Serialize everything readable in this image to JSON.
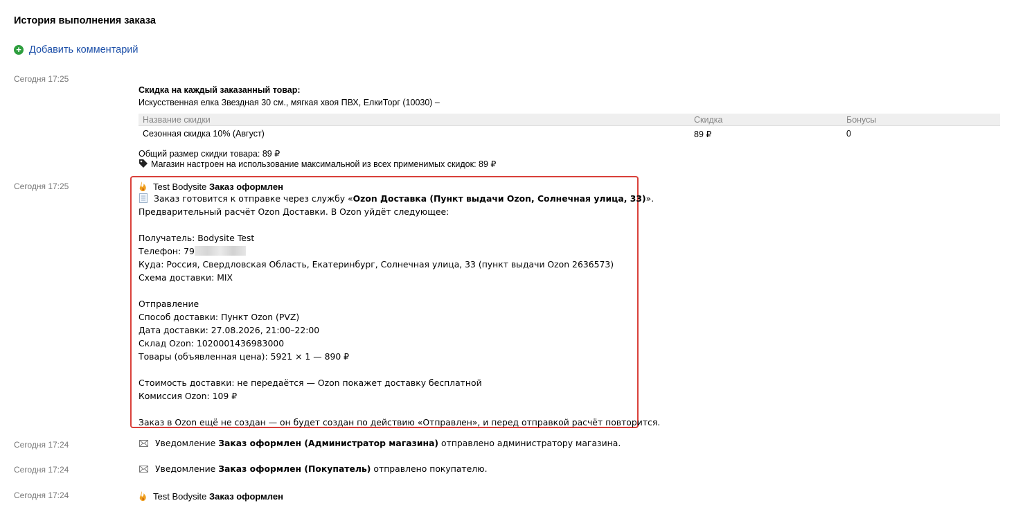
{
  "header": {
    "title": "История выполнения заказа"
  },
  "add_comment": {
    "label": "Добавить комментарий"
  },
  "entries": [
    {
      "time": "Сегодня 17:25",
      "discount_title": "Скидка на каждый заказанный товар:",
      "product": "Искусственная елка Звездная 30 см., мягкая хвоя ПВХ, ЕлкиТорг (10030) –",
      "table": {
        "headers": [
          "Название скидки",
          "Скидка",
          "Бонусы"
        ],
        "rows": [
          [
            "Сезонная скидка 10% (Август)",
            "89 ₽",
            "0"
          ]
        ]
      },
      "total": "Общий размер скидки товара: 89 ₽",
      "max_note": "Магазин настроен на использование максимальной из всех применимых скидок: 89 ₽"
    },
    {
      "time": "Сегодня 17:25",
      "author": "Test Bodysite",
      "status": "Заказ оформлен",
      "ship_prefix": "Заказ готовится к отправке через службу «",
      "ship_service": "Ozon Доставка (Пункт выдачи Ozon, Солнечная улица, 33)",
      "ship_suffix": "».",
      "prelim": "Предварительный расчёт Ozon Доставки. В Ozon уйдёт следующее:",
      "recipient": "Получатель: Bodysite Test",
      "phone_label": "Телефон: 79",
      "to": "Куда: Россия, Свердловская Область, Екатеринбург, Солнечная улица, 33 (пункт выдачи Ozon 2636573)",
      "scheme": "Схема доставки: MIX",
      "shipment": "Отправление",
      "method": "Способ доставки: Пункт Ozon (PVZ)",
      "date": "Дата доставки: 27.08.2026, 21:00–22:00",
      "warehouse": "Склад Ozon: 1020001436983000",
      "goods": "Товары (объявленная цена): 5921 × 1 — 890 ₽",
      "cost": "Стоимость доставки: не передаётся — Ozon покажет доставку бесплатной",
      "commission": "Комиссия Ozon: 109 ₽",
      "footer": "Заказ в Ozon ещё не создан — он будет создан по действию «Отправлен», и перед отправкой расчёт повторится."
    },
    {
      "time": "Сегодня 17:24",
      "prefix": "Уведомление ",
      "bold": "Заказ оформлен (Администратор магазина)",
      "suffix": " отправлено администратору магазина."
    },
    {
      "time": "Сегодня 17:24",
      "prefix": "Уведомление ",
      "bold": "Заказ оформлен (Покупатель)",
      "suffix": " отправлено покупателю."
    },
    {
      "time": "Сегодня 17:24",
      "author": "Test Bodysite",
      "status": "Заказ оформлен"
    }
  ],
  "colors": {
    "link": "#1c4fa8",
    "add_icon": "#2e9e3e",
    "highlight_border": "#d9403a"
  }
}
